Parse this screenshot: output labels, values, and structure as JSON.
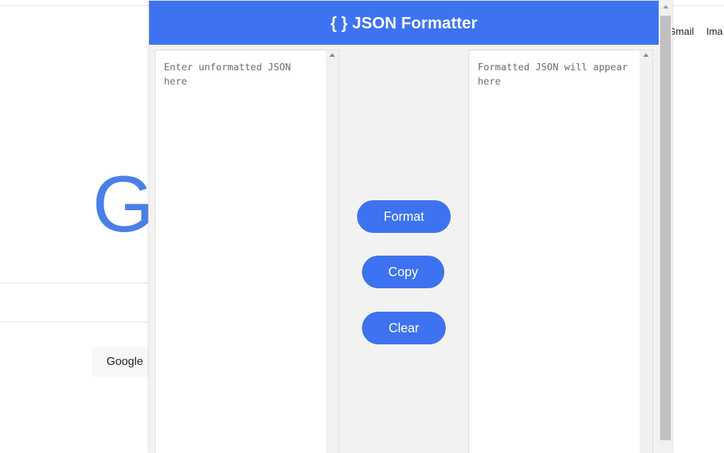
{
  "background": {
    "links": [
      "Gmail",
      "Ima"
    ],
    "logo_letter": "G",
    "search_button": "Google"
  },
  "extension": {
    "title": "{ } JSON Formatter",
    "input": {
      "placeholder": "Enter unformatted JSON here"
    },
    "output": {
      "placeholder": "Formatted JSON will appear here"
    },
    "buttons": {
      "format": "Format",
      "copy": "Copy",
      "clear": "Clear"
    }
  },
  "colors": {
    "accent": "#3d73f0",
    "panel_bg": "#f2f2f2"
  }
}
